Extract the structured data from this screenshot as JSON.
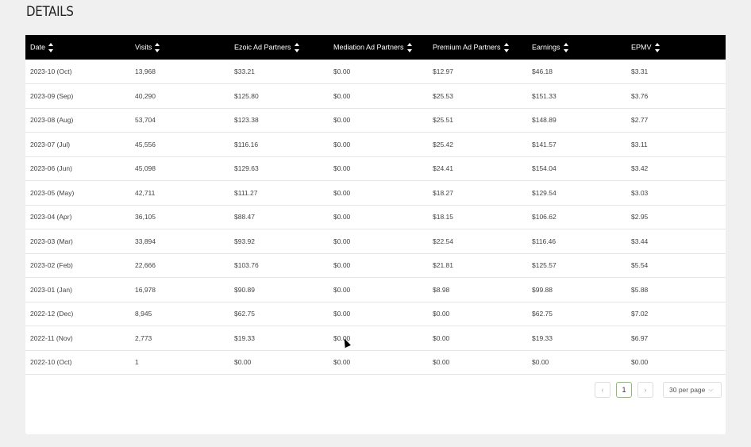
{
  "page": {
    "title": "DETAILS"
  },
  "table": {
    "columns": [
      "Date",
      "Visits",
      "Ezoic Ad Partners",
      "Mediation Ad Partners",
      "Premium Ad Partners",
      "Earnings",
      "EPMV"
    ],
    "rows": [
      [
        "2023-10 (Oct)",
        "13,968",
        "$33.21",
        "$0.00",
        "$12.97",
        "$46.18",
        "$3.31"
      ],
      [
        "2023-09 (Sep)",
        "40,290",
        "$125.80",
        "$0.00",
        "$25.53",
        "$151.33",
        "$3.76"
      ],
      [
        "2023-08 (Aug)",
        "53,704",
        "$123.38",
        "$0.00",
        "$25.51",
        "$148.89",
        "$2.77"
      ],
      [
        "2023-07 (Jul)",
        "45,556",
        "$116.16",
        "$0.00",
        "$25.42",
        "$141.57",
        "$3.11"
      ],
      [
        "2023-06 (Jun)",
        "45,098",
        "$129.63",
        "$0.00",
        "$24.41",
        "$154.04",
        "$3.42"
      ],
      [
        "2023-05 (May)",
        "42,711",
        "$111.27",
        "$0.00",
        "$18.27",
        "$129.54",
        "$3.03"
      ],
      [
        "2023-04 (Apr)",
        "36,105",
        "$88.47",
        "$0.00",
        "$18.15",
        "$106.62",
        "$2.95"
      ],
      [
        "2023-03 (Mar)",
        "33,894",
        "$93.92",
        "$0.00",
        "$22.54",
        "$116.46",
        "$3.44"
      ],
      [
        "2023-02 (Feb)",
        "22,666",
        "$103.76",
        "$0.00",
        "$21.81",
        "$125.57",
        "$5.54"
      ],
      [
        "2023-01 (Jan)",
        "16,978",
        "$90.89",
        "$0.00",
        "$8.98",
        "$99.88",
        "$5.88"
      ],
      [
        "2022-12 (Dec)",
        "8,945",
        "$62.75",
        "$0.00",
        "$0.00",
        "$62.75",
        "$7.02"
      ],
      [
        "2022-11 (Nov)",
        "2,773",
        "$19.33",
        "$0.00",
        "$0.00",
        "$19.33",
        "$6.97"
      ],
      [
        "2022-10 (Oct)",
        "1",
        "$0.00",
        "$0.00",
        "$0.00",
        "$0.00",
        "$0.00"
      ]
    ]
  },
  "pagination": {
    "prev": "‹",
    "current_page": "1",
    "next": "›",
    "per_page": "30 per page",
    "chevron": "⌵"
  }
}
